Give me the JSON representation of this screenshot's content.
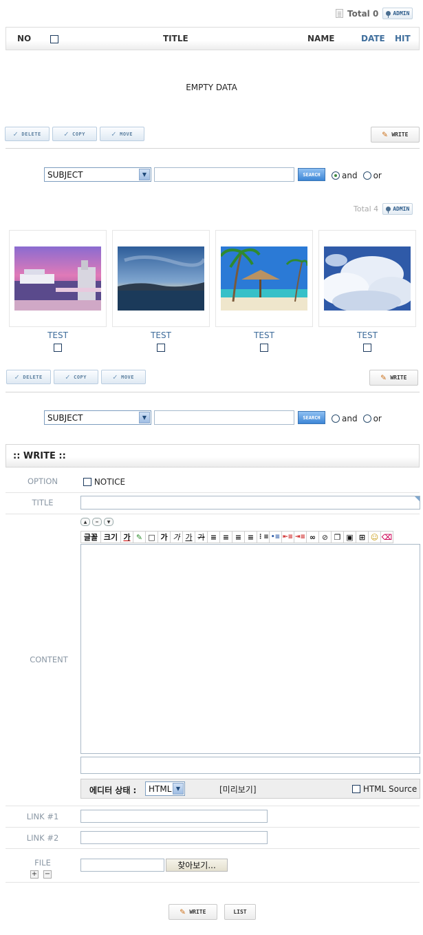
{
  "board1": {
    "total_label": "Total 0",
    "admin_label": "ADMIN",
    "columns": {
      "no": "NO",
      "title": "TITLE",
      "name": "NAME",
      "date": "DATE",
      "hit": "HIT"
    },
    "empty_text": "EMPTY DATA",
    "buttons": {
      "delete": "DELETE",
      "copy": "COPY",
      "move": "MOVE",
      "write": "WRITE"
    },
    "search": {
      "field": "SUBJECT",
      "button": "SEARCH",
      "and_label": "and",
      "or_label": "or",
      "selected": "and"
    }
  },
  "board2": {
    "total_label": "Total 4",
    "admin_label": "ADMIN",
    "items": [
      {
        "caption": "TEST",
        "image": "harbor-sunset-photo"
      },
      {
        "caption": "TEST",
        "image": "sea-dusk-photo"
      },
      {
        "caption": "TEST",
        "image": "beach-hut-photo"
      },
      {
        "caption": "TEST",
        "image": "clouds-photo"
      }
    ],
    "buttons": {
      "delete": "DELETE",
      "copy": "COPY",
      "move": "MOVE",
      "write": "WRITE"
    },
    "search": {
      "field": "SUBJECT",
      "button": "SEARCH",
      "and_label": "and",
      "or_label": "or",
      "selected": "none"
    }
  },
  "write": {
    "title": ":: WRITE ::",
    "labels": {
      "option": "OPTION",
      "title": "TITLE",
      "content": "CONTENT",
      "link1": "LINK #1",
      "link2": "LINK #2",
      "file": "FILE"
    },
    "notice_label": "NOTICE",
    "toolbar": [
      "글꼴",
      "크기",
      "가",
      "✎",
      "□",
      "가",
      "가",
      "가",
      "가"
    ],
    "editor_status_label": "에디터 상태 :",
    "editor_mode": "HTML",
    "preview_label": "[미리보기]",
    "html_source_label": "HTML Source",
    "browse_label": "찾아보기...",
    "buttons": {
      "write": "WRITE",
      "list": "LIST"
    }
  }
}
